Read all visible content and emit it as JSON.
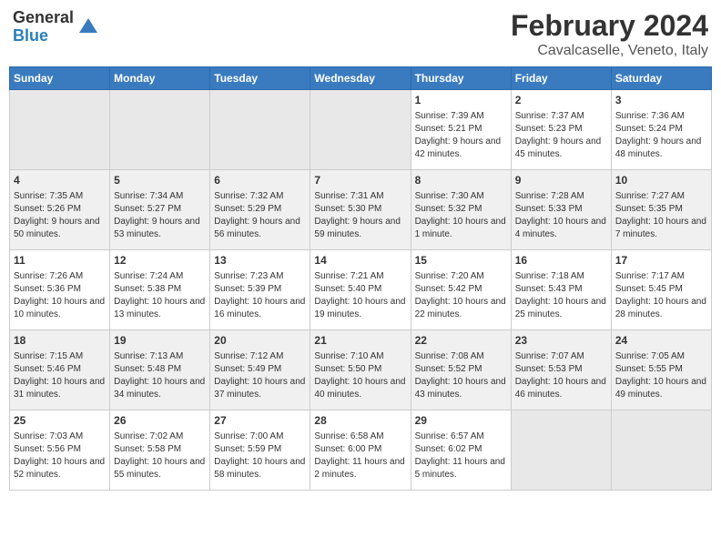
{
  "header": {
    "logo_general": "General",
    "logo_blue": "Blue",
    "month_year": "February 2024",
    "location": "Cavalcaselle, Veneto, Italy"
  },
  "days_of_week": [
    "Sunday",
    "Monday",
    "Tuesday",
    "Wednesday",
    "Thursday",
    "Friday",
    "Saturday"
  ],
  "weeks": [
    [
      {
        "day": "",
        "content": ""
      },
      {
        "day": "",
        "content": ""
      },
      {
        "day": "",
        "content": ""
      },
      {
        "day": "",
        "content": ""
      },
      {
        "day": "1",
        "content": "Sunrise: 7:39 AM\nSunset: 5:21 PM\nDaylight: 9 hours and 42 minutes."
      },
      {
        "day": "2",
        "content": "Sunrise: 7:37 AM\nSunset: 5:23 PM\nDaylight: 9 hours and 45 minutes."
      },
      {
        "day": "3",
        "content": "Sunrise: 7:36 AM\nSunset: 5:24 PM\nDaylight: 9 hours and 48 minutes."
      }
    ],
    [
      {
        "day": "4",
        "content": "Sunrise: 7:35 AM\nSunset: 5:26 PM\nDaylight: 9 hours and 50 minutes."
      },
      {
        "day": "5",
        "content": "Sunrise: 7:34 AM\nSunset: 5:27 PM\nDaylight: 9 hours and 53 minutes."
      },
      {
        "day": "6",
        "content": "Sunrise: 7:32 AM\nSunset: 5:29 PM\nDaylight: 9 hours and 56 minutes."
      },
      {
        "day": "7",
        "content": "Sunrise: 7:31 AM\nSunset: 5:30 PM\nDaylight: 9 hours and 59 minutes."
      },
      {
        "day": "8",
        "content": "Sunrise: 7:30 AM\nSunset: 5:32 PM\nDaylight: 10 hours and 1 minute."
      },
      {
        "day": "9",
        "content": "Sunrise: 7:28 AM\nSunset: 5:33 PM\nDaylight: 10 hours and 4 minutes."
      },
      {
        "day": "10",
        "content": "Sunrise: 7:27 AM\nSunset: 5:35 PM\nDaylight: 10 hours and 7 minutes."
      }
    ],
    [
      {
        "day": "11",
        "content": "Sunrise: 7:26 AM\nSunset: 5:36 PM\nDaylight: 10 hours and 10 minutes."
      },
      {
        "day": "12",
        "content": "Sunrise: 7:24 AM\nSunset: 5:38 PM\nDaylight: 10 hours and 13 minutes."
      },
      {
        "day": "13",
        "content": "Sunrise: 7:23 AM\nSunset: 5:39 PM\nDaylight: 10 hours and 16 minutes."
      },
      {
        "day": "14",
        "content": "Sunrise: 7:21 AM\nSunset: 5:40 PM\nDaylight: 10 hours and 19 minutes."
      },
      {
        "day": "15",
        "content": "Sunrise: 7:20 AM\nSunset: 5:42 PM\nDaylight: 10 hours and 22 minutes."
      },
      {
        "day": "16",
        "content": "Sunrise: 7:18 AM\nSunset: 5:43 PM\nDaylight: 10 hours and 25 minutes."
      },
      {
        "day": "17",
        "content": "Sunrise: 7:17 AM\nSunset: 5:45 PM\nDaylight: 10 hours and 28 minutes."
      }
    ],
    [
      {
        "day": "18",
        "content": "Sunrise: 7:15 AM\nSunset: 5:46 PM\nDaylight: 10 hours and 31 minutes."
      },
      {
        "day": "19",
        "content": "Sunrise: 7:13 AM\nSunset: 5:48 PM\nDaylight: 10 hours and 34 minutes."
      },
      {
        "day": "20",
        "content": "Sunrise: 7:12 AM\nSunset: 5:49 PM\nDaylight: 10 hours and 37 minutes."
      },
      {
        "day": "21",
        "content": "Sunrise: 7:10 AM\nSunset: 5:50 PM\nDaylight: 10 hours and 40 minutes."
      },
      {
        "day": "22",
        "content": "Sunrise: 7:08 AM\nSunset: 5:52 PM\nDaylight: 10 hours and 43 minutes."
      },
      {
        "day": "23",
        "content": "Sunrise: 7:07 AM\nSunset: 5:53 PM\nDaylight: 10 hours and 46 minutes."
      },
      {
        "day": "24",
        "content": "Sunrise: 7:05 AM\nSunset: 5:55 PM\nDaylight: 10 hours and 49 minutes."
      }
    ],
    [
      {
        "day": "25",
        "content": "Sunrise: 7:03 AM\nSunset: 5:56 PM\nDaylight: 10 hours and 52 minutes."
      },
      {
        "day": "26",
        "content": "Sunrise: 7:02 AM\nSunset: 5:58 PM\nDaylight: 10 hours and 55 minutes."
      },
      {
        "day": "27",
        "content": "Sunrise: 7:00 AM\nSunset: 5:59 PM\nDaylight: 10 hours and 58 minutes."
      },
      {
        "day": "28",
        "content": "Sunrise: 6:58 AM\nSunset: 6:00 PM\nDaylight: 11 hours and 2 minutes."
      },
      {
        "day": "29",
        "content": "Sunrise: 6:57 AM\nSunset: 6:02 PM\nDaylight: 11 hours and 5 minutes."
      },
      {
        "day": "",
        "content": ""
      },
      {
        "day": "",
        "content": ""
      }
    ]
  ]
}
